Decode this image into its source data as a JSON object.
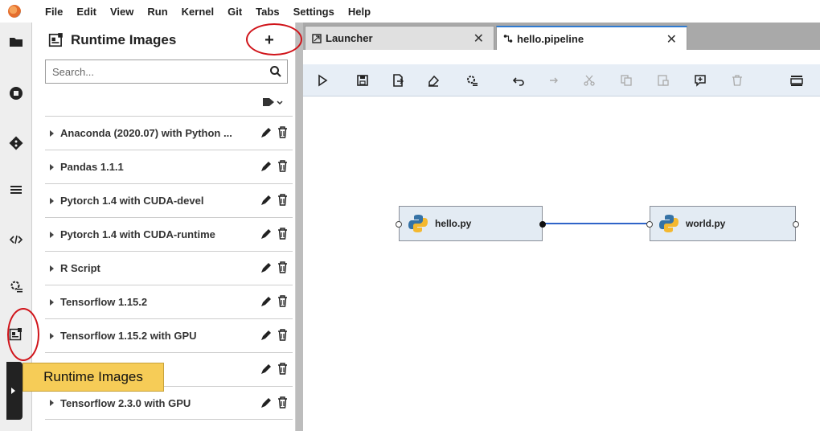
{
  "menubar": {
    "items": [
      "File",
      "Edit",
      "View",
      "Run",
      "Kernel",
      "Git",
      "Tabs",
      "Settings",
      "Help"
    ]
  },
  "leftbar": {
    "icons": [
      "folder-icon",
      "stop-circle-icon",
      "git-icon",
      "list-icon",
      "code-icon",
      "settings-gear-icon",
      "runtime-images-icon"
    ]
  },
  "panel": {
    "title": "Runtime Images",
    "add_label": "+",
    "search_placeholder": "Search...",
    "items": [
      {
        "label": "Anaconda (2020.07) with Python ..."
      },
      {
        "label": "Pandas 1.1.1"
      },
      {
        "label": "Pytorch 1.4 with CUDA-devel"
      },
      {
        "label": "Pytorch 1.4 with CUDA-runtime"
      },
      {
        "label": "R Script"
      },
      {
        "label": "Tensorflow 1.15.2"
      },
      {
        "label": "Tensorflow 1.15.2 with GPU"
      },
      {
        "label": ""
      },
      {
        "label": "Tensorflow 2.3.0 with GPU"
      }
    ]
  },
  "tooltip": {
    "text": "Runtime Images"
  },
  "tabs": [
    {
      "label": "Launcher",
      "close": "✕"
    },
    {
      "label": "hello.pipeline",
      "close": "✕"
    }
  ],
  "nodes": [
    {
      "label": "hello.py"
    },
    {
      "label": "world.py"
    }
  ],
  "colors": {
    "accent": "#2f64c8",
    "annotation": "#d0141a",
    "tooltip": "#f6cc57",
    "toolbar": "#e7eef6"
  }
}
